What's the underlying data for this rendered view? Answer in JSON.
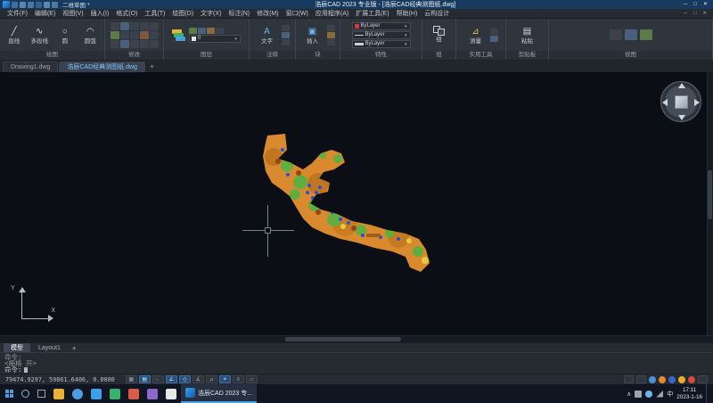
{
  "window": {
    "title": "浩辰CAD 2023 专业版 - [浩辰CAD经典测图纸.dwg]",
    "workspace": "二维草图",
    "controls": {
      "minimize": "─",
      "maximize": "□",
      "close": "✕"
    }
  },
  "menu": {
    "items": [
      "文件(F)",
      "编辑(E)",
      "视图(V)",
      "插入(I)",
      "格式(O)",
      "工具(T)",
      "绘图(D)",
      "文字(X)",
      "标注(N)",
      "修改(M)",
      "窗口(W)",
      "应用程序(A)",
      "扩展工具(E)",
      "帮助(H)",
      "云构设计"
    ]
  },
  "ribbon": {
    "panels": [
      {
        "label": "绘图",
        "buttons": [
          {
            "label": "直线",
            "icon": "╱"
          },
          {
            "label": "多段线",
            "icon": "∿"
          },
          {
            "label": "圆",
            "icon": "○"
          },
          {
            "label": "圆弧",
            "icon": "◠"
          }
        ]
      },
      {
        "label": "修改"
      },
      {
        "label": "图层",
        "layer_value": "0"
      },
      {
        "label": "注释",
        "buttons": [
          {
            "label": "文字",
            "icon": "A"
          }
        ]
      },
      {
        "label": "块",
        "buttons": [
          {
            "label": "插入",
            "icon": "▣"
          }
        ]
      },
      {
        "label": "特性",
        "rows": [
          {
            "value": "ByLayer"
          },
          {
            "value": "ByLayer"
          },
          {
            "value": "ByLayer"
          }
        ]
      },
      {
        "label": "组",
        "buttons": [
          {
            "label": "组"
          }
        ]
      },
      {
        "label": "实用工具",
        "buttons": [
          {
            "label": "测量",
            "icon": "⊿"
          }
        ]
      },
      {
        "label": "剪贴板",
        "buttons": [
          {
            "label": "粘贴",
            "icon": "▤"
          }
        ]
      },
      {
        "label": "视图"
      }
    ]
  },
  "doc_tabs": {
    "tabs": [
      {
        "label": "Drawing1.dwg"
      },
      {
        "label": "浩辰CAD经典测图纸.dwg"
      }
    ],
    "new_tab": "+"
  },
  "canvas": {
    "ucs": {
      "x": "X",
      "y": "Y"
    },
    "map_colors": {
      "base": "#d98a2e",
      "green": "#5fae3f",
      "blue": "#2e4fd0",
      "dark_orange": "#c0751f",
      "maroon": "#9a4318",
      "yellow": "#e7c93f"
    }
  },
  "layout_tabs": {
    "tabs": [
      {
        "label": "模型"
      },
      {
        "label": "Layout1"
      }
    ],
    "new_tab": "+"
  },
  "command": {
    "lines": [
      "命令:",
      "<栅格 开>",
      "命令:"
    ]
  },
  "status": {
    "coordinates": "79474.9297, 59861.6406, 0.0000",
    "toggles": [
      "snap",
      "grid",
      "ortho",
      "polar",
      "osnap",
      "otrack",
      "ducs",
      "dyn",
      "lwt",
      "transparency"
    ]
  },
  "taskbar": {
    "app_label": "浩辰CAD 2023 专...",
    "tray": {
      "ime": "中",
      "time": "17:11",
      "date": "2023-1-16"
    }
  }
}
